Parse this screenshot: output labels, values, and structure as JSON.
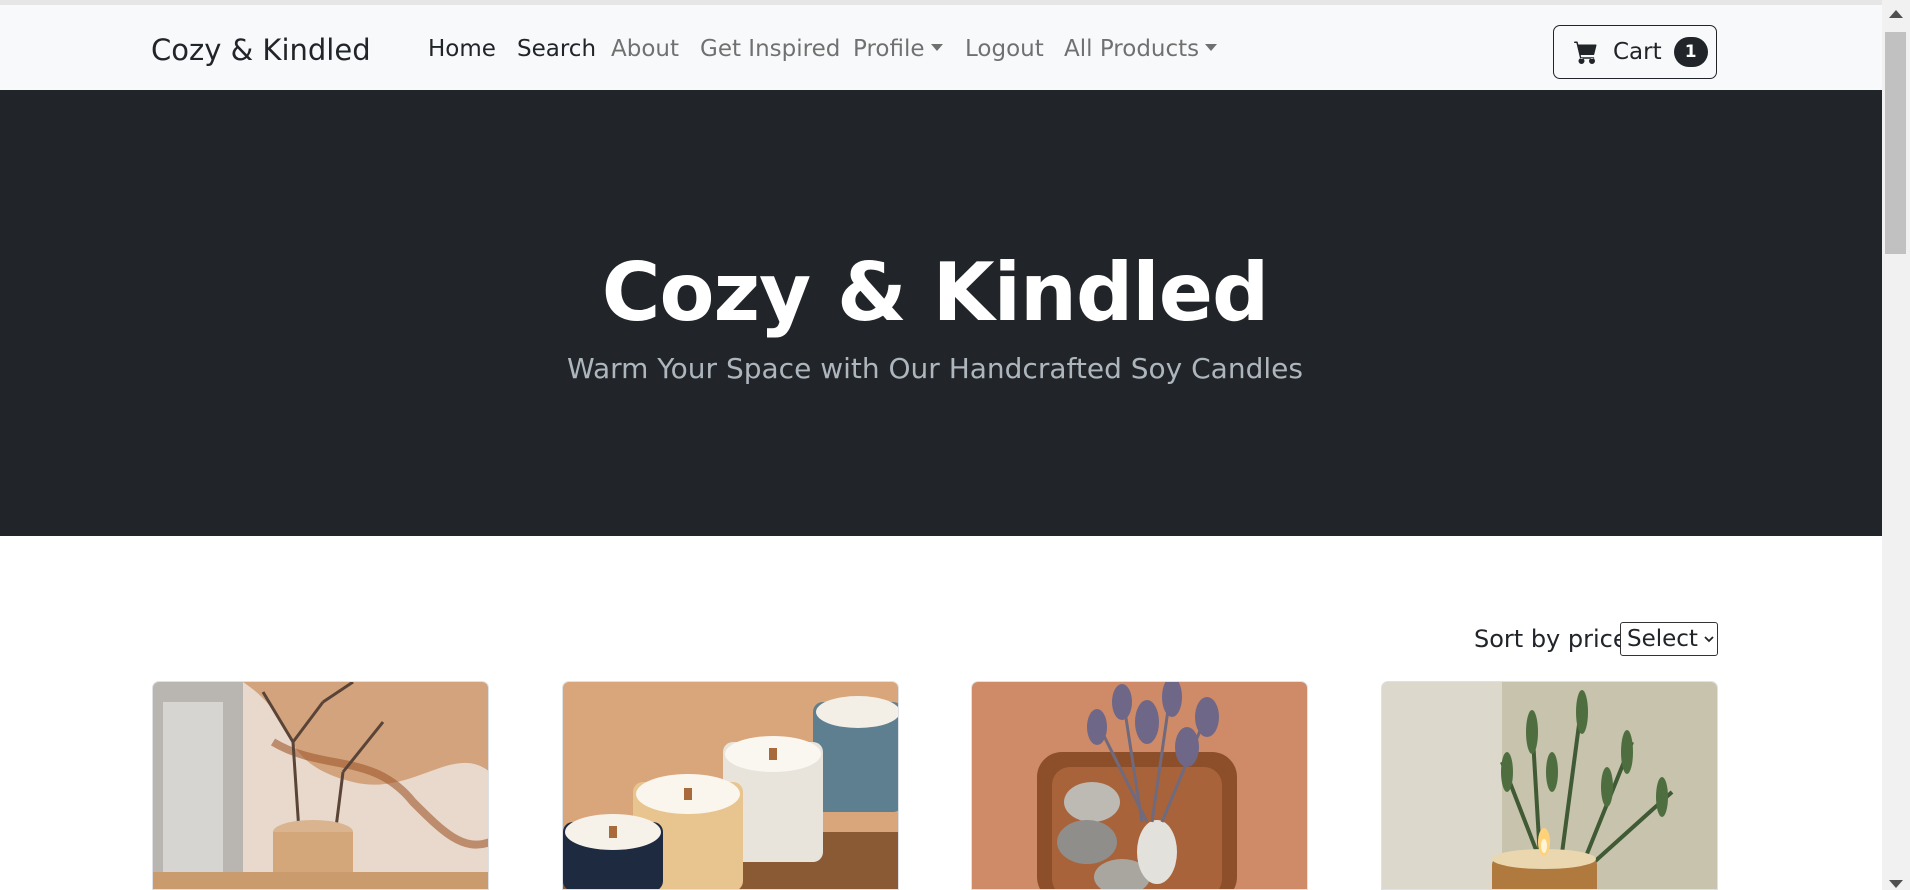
{
  "navbar": {
    "brand": "Cozy & Kindled",
    "links": [
      {
        "label": "Home"
      },
      {
        "label": "Search"
      },
      {
        "label": "About"
      },
      {
        "label": "Get Inspired"
      },
      {
        "label": "Profile"
      },
      {
        "label": "Logout"
      },
      {
        "label": "All Products"
      }
    ],
    "cart": {
      "label": "Cart",
      "count": "1"
    }
  },
  "hero": {
    "title": "Cozy & Kindled",
    "subtitle": "Warm Your Space with Our Handcrafted Soy Candles"
  },
  "sort": {
    "label": "Sort by price:",
    "selected": "Select"
  },
  "products": [
    {
      "image": "marble candle with branches"
    },
    {
      "image": "speckled ceramic soy candles"
    },
    {
      "image": "lavender and stones tray"
    },
    {
      "image": "rosemary candle"
    }
  ],
  "colors": {
    "dark": "#212529",
    "navbar_bg": "#f8f9fa",
    "muted": "#adb5bd"
  }
}
